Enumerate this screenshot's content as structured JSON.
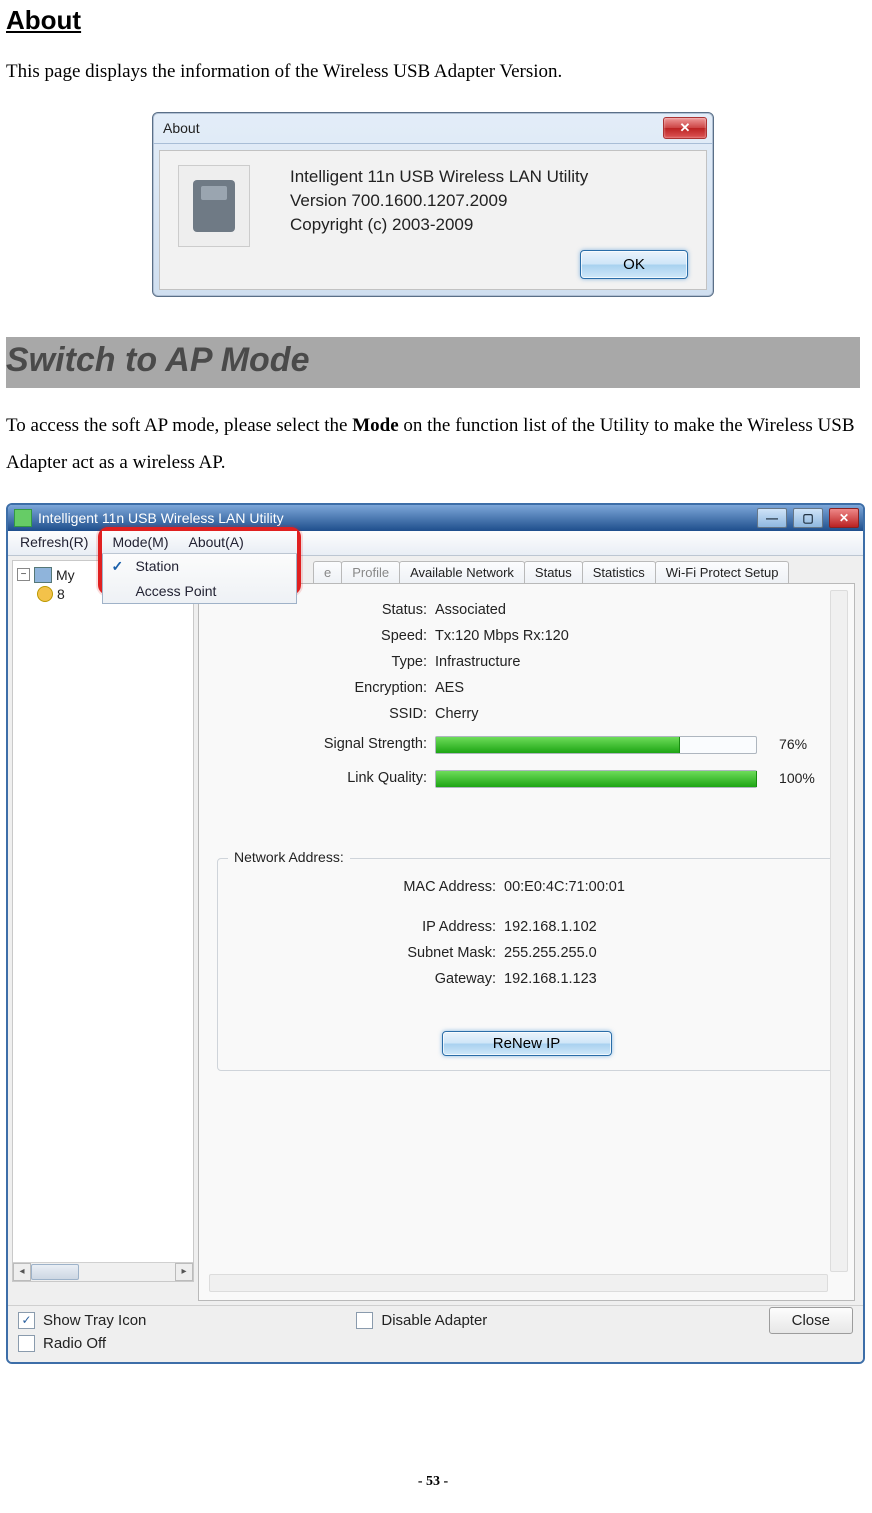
{
  "doc": {
    "heading_about": "About",
    "about_desc": "This page displays the information of the Wireless USB Adapter Version.",
    "section_switch": "Switch to AP Mode",
    "switch_desc_pre": "To access the soft AP mode, please select the ",
    "switch_desc_bold": "Mode",
    "switch_desc_post": " on the function list of the Utility to make the Wireless USB Adapter act as a wireless AP.",
    "page_number": "- 53 -"
  },
  "about_dialog": {
    "title": "About",
    "line1": "Intelligent 11n USB Wireless LAN Utility",
    "line2": "Version 700.1600.1207.2009",
    "line3": "Copyright (c) 2003-2009",
    "ok": "OK"
  },
  "utility": {
    "title": "Intelligent 11n USB Wireless LAN Utility",
    "menu": {
      "refresh": "Refresh(R)",
      "mode": "Mode(M)",
      "about": "About(A)",
      "dropdown": {
        "station": "Station",
        "access_point": "Access Point"
      }
    },
    "tree": {
      "root_partial": "My",
      "child_partial": "8"
    },
    "tabs": {
      "general_partial": "e",
      "profile": "Profile",
      "available_network": "Available Network",
      "status": "Status",
      "statistics": "Statistics",
      "wps": "Wi-Fi Protect Setup"
    },
    "general": {
      "status_label": "Status:",
      "status_value": "Associated",
      "speed_label": "Speed:",
      "speed_value": "Tx:120 Mbps Rx:120",
      "type_label": "Type:",
      "type_value": "Infrastructure",
      "encryption_label": "Encryption:",
      "encryption_value": "AES",
      "ssid_label": "SSID:",
      "ssid_value": "Cherry",
      "signal_label": "Signal Strength:",
      "signal_pct": "76%",
      "link_label": "Link Quality:",
      "link_pct": "100%"
    },
    "network_address": {
      "legend": "Network Address:",
      "mac_label": "MAC Address:",
      "mac_value": "00:E0:4C:71:00:01",
      "ip_label": "IP Address:",
      "ip_value": "192.168.1.102",
      "subnet_label": "Subnet Mask:",
      "subnet_value": "255.255.255.0",
      "gateway_label": "Gateway:",
      "gateway_value": "192.168.1.123",
      "renew": "ReNew IP"
    },
    "footer": {
      "show_tray": "Show Tray Icon",
      "disable_adapter": "Disable Adapter",
      "radio_off": "Radio Off",
      "close": "Close"
    }
  },
  "chart_data": {
    "type": "bar",
    "title": "Wireless connection quality meters",
    "series": [
      {
        "name": "Signal Strength",
        "value": 76,
        "max": 100
      },
      {
        "name": "Link Quality",
        "value": 100,
        "max": 100
      }
    ],
    "xlabel": "",
    "ylabel": "%"
  }
}
